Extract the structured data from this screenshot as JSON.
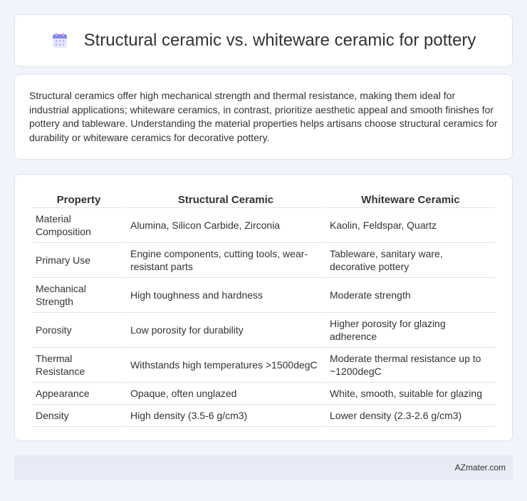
{
  "header": {
    "title": "Structural ceramic vs. whiteware ceramic for pottery",
    "icon": "calendar-icon"
  },
  "intro": {
    "text": "Structural ceramics offer high mechanical strength and thermal resistance, making them ideal for industrial applications; whiteware ceramics, in contrast, prioritize aesthetic appeal and smooth finishes for pottery and tableware. Understanding the material properties helps artisans choose structural ceramics for durability or whiteware ceramics for decorative pottery."
  },
  "table": {
    "headers": [
      "Property",
      "Structural Ceramic",
      "Whiteware Ceramic"
    ],
    "rows": [
      [
        "Material Composition",
        "Alumina, Silicon Carbide, Zirconia",
        "Kaolin, Feldspar, Quartz"
      ],
      [
        "Primary Use",
        "Engine components, cutting tools, wear-resistant parts",
        "Tableware, sanitary ware, decorative pottery"
      ],
      [
        "Mechanical Strength",
        "High toughness and hardness",
        "Moderate strength"
      ],
      [
        "Porosity",
        "Low porosity for durability",
        "Higher porosity for glazing adherence"
      ],
      [
        "Thermal Resistance",
        "Withstands high temperatures >1500degC",
        "Moderate thermal resistance up to ~1200degC"
      ],
      [
        "Appearance",
        "Opaque, often unglazed",
        "White, smooth, suitable for glazing"
      ],
      [
        "Density",
        "High density (3.5-6 g/cm3)",
        "Lower density (2.3-2.6 g/cm3)"
      ]
    ]
  },
  "footer": {
    "text": "AZmater.com"
  },
  "colors": {
    "background": "#f1f4fa",
    "card": "#ffffff",
    "border": "#dde3ec",
    "footer_bg": "#e6ebf5"
  }
}
